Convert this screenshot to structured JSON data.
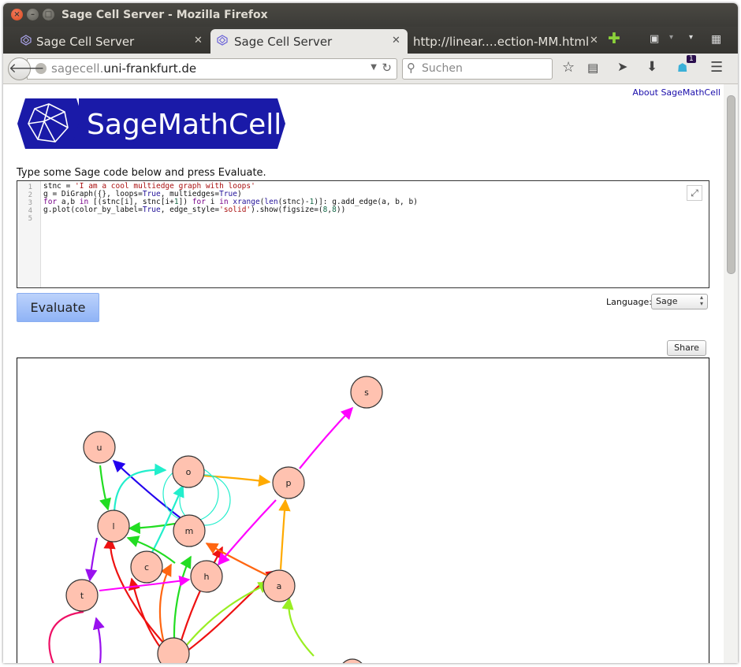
{
  "window": {
    "title": "Sage Cell Server - Mozilla Firefox"
  },
  "tabs": [
    {
      "label": "Sage Cell Server",
      "active": false
    },
    {
      "label": "Sage Cell Server",
      "active": true
    },
    {
      "label": "http://linear.…ection-MM.html",
      "active": false
    }
  ],
  "nav": {
    "url_prefix": "sagecell.",
    "url_host": "uni-frankfurt.de",
    "search_placeholder": "Suchen",
    "notification_badge": "1"
  },
  "page": {
    "about_link": "About SageMathCell",
    "logo_text": "SageMathCell",
    "instructions": "Type some Sage code below and press Evaluate.",
    "line_numbers": [
      "1",
      "2",
      "3",
      "4",
      "5"
    ],
    "evaluate_label": "Evaluate",
    "language_label": "Language:",
    "language_value": "Sage",
    "share_label": "Share"
  },
  "graph": {
    "nodes": [
      {
        "id": "s",
        "label": "s",
        "color": "#ffc2b0"
      },
      {
        "id": "u",
        "label": "u",
        "color": "#ffc2b0"
      },
      {
        "id": "o",
        "label": "o",
        "color": "#ffc2b0"
      },
      {
        "id": "p",
        "label": "p",
        "color": "#ffc2b0"
      },
      {
        "id": "l",
        "label": "l",
        "color": "#ffc2b0"
      },
      {
        "id": "m",
        "label": "m",
        "color": "#ffc2b0"
      },
      {
        "id": "c",
        "label": "c",
        "color": "#ffc2b0"
      },
      {
        "id": "h",
        "label": "h",
        "color": "#ffc2b0"
      },
      {
        "id": "a",
        "label": "a",
        "color": "#ffc2b0"
      },
      {
        "id": "t",
        "label": "t",
        "color": "#ffc2b0"
      },
      {
        "id": "space",
        "label": "",
        "color": "#ffc2b0"
      },
      {
        "id": "e",
        "label": "",
        "color": "#ffc2b0"
      }
    ]
  },
  "colors": {
    "accent": "#1a1aa8",
    "link": "#1a0dab"
  }
}
